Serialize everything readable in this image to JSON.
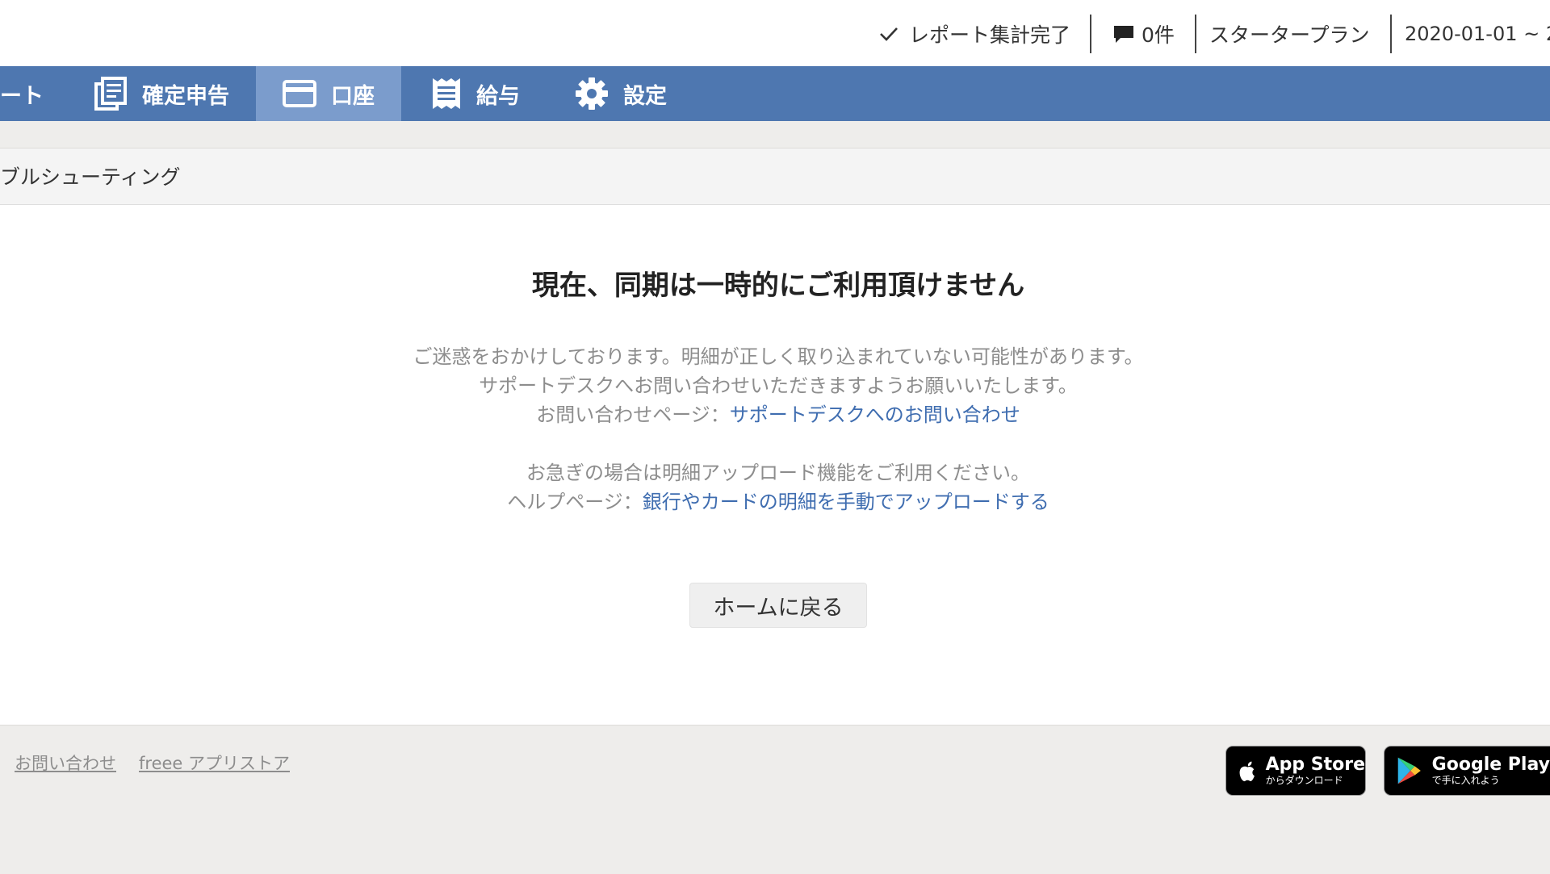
{
  "topbar": {
    "report_status": "レポート集計完了",
    "notifications": "0件",
    "plan": "スタータープラン",
    "period": "2020-01-01 ~ 2"
  },
  "nav": {
    "items": [
      {
        "label": "ート",
        "icon": "none"
      },
      {
        "label": "確定申告",
        "icon": "document-stack-icon"
      },
      {
        "label": "口座",
        "icon": "card-icon",
        "active": true
      },
      {
        "label": "給与",
        "icon": "receipt-icon"
      },
      {
        "label": "設定",
        "icon": "gear-icon"
      }
    ]
  },
  "breadcrumb": "ブルシューティング",
  "main": {
    "title": "現在、同期は一時的にご利用頂けません",
    "line1": "ご迷惑をおかけしております。明細が正しく取り込まれていない可能性があります。",
    "line2": "サポートデスクへお問い合わせいただきますようお願いいたします。",
    "contact_prefix": "お問い合わせページ：",
    "contact_link": "サポートデスクへのお問い合わせ",
    "line4": "お急ぎの場合は明細アップロード機能をご利用ください。",
    "help_prefix": "ヘルプページ：",
    "help_link": "銀行やカードの明細を手動でアップロードする",
    "home_button": "ホームに戻る"
  },
  "footer": {
    "contact": "お問い合わせ",
    "appstore_link": "freee アプリストア",
    "appstore_badge": {
      "title": "App Store",
      "subtitle": "からダウンロード"
    },
    "googleplay_badge": {
      "title": "Google Play",
      "subtitle": "で手に入れよう"
    }
  },
  "colors": {
    "nav": "#4e77b0",
    "nav_active": "#7b9ccc",
    "link": "#3f6db0",
    "muted_text": "#8d8d8d"
  }
}
